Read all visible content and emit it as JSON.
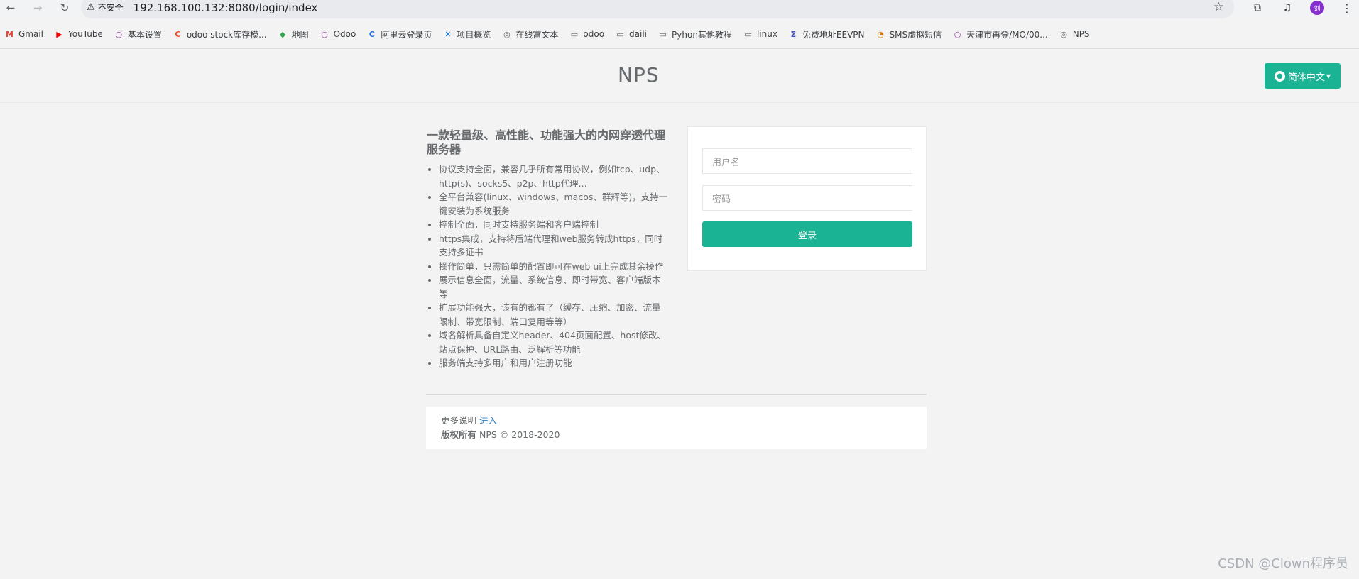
{
  "browser": {
    "security_label": "不安全",
    "url": "192.168.100.132:8080/login/index",
    "avatar_text": "刘",
    "bookmarks": [
      {
        "label": "Gmail",
        "icon": "gmail-icon",
        "color": "#ea4335"
      },
      {
        "label": "YouTube",
        "icon": "youtube-icon",
        "color": "#ff0000"
      },
      {
        "label": "基本设置",
        "icon": "circle-icon",
        "color": "#8e3b97"
      },
      {
        "label": "odoo stock库存模...",
        "icon": "c-icon",
        "color": "#f4511e"
      },
      {
        "label": "地图",
        "icon": "maps-icon",
        "color": "#34a853"
      },
      {
        "label": "Odoo",
        "icon": "circle-icon",
        "color": "#8e3b97"
      },
      {
        "label": "阿里云登录页",
        "icon": "c-icon",
        "color": "#1a73e8"
      },
      {
        "label": "项目概览",
        "icon": "x-icon",
        "color": "#1a73e8"
      },
      {
        "label": "在线富文本",
        "icon": "globe-icon",
        "color": "#5f6368"
      },
      {
        "label": "odoo",
        "icon": "folder-icon",
        "color": "#5f6368"
      },
      {
        "label": "daili",
        "icon": "folder-icon",
        "color": "#5f6368"
      },
      {
        "label": "Pyhon其他教程",
        "icon": "folder-icon",
        "color": "#5f6368"
      },
      {
        "label": "linux",
        "icon": "folder-icon",
        "color": "#5f6368"
      },
      {
        "label": "免费地址EEVPN",
        "icon": "sigma-icon",
        "color": "#3f51b5"
      },
      {
        "label": "SMS虚拟短信",
        "icon": "sms-icon",
        "color": "#e37400"
      },
      {
        "label": "天津市再登/MO/00...",
        "icon": "circle-icon",
        "color": "#8e3b97"
      },
      {
        "label": "NPS",
        "icon": "globe-icon",
        "color": "#5f6368"
      }
    ]
  },
  "header": {
    "brand": "NPS",
    "language": "简体中文"
  },
  "intro": {
    "title": "一款轻量级、高性能、功能强大的内网穿透代理服务器",
    "features": [
      "协议支持全面，兼容几乎所有常用协议，例如tcp、udp、http(s)、socks5、p2p、http代理...",
      "全平台兼容(linux、windows、macos、群辉等)，支持一键安装为系统服务",
      "控制全面，同时支持服务端和客户端控制",
      "https集成，支持将后端代理和web服务转成https，同时支持多证书",
      "操作简单，只需简单的配置即可在web ui上完成其余操作",
      "展示信息全面，流量、系统信息、即时带宽、客户端版本等",
      "扩展功能强大，该有的都有了（缓存、压缩、加密、流量限制、带宽限制、端口复用等等）",
      "域名解析具备自定义header、404页面配置、host修改、站点保护、URL路由、泛解析等功能",
      "服务端支持多用户和用户注册功能"
    ]
  },
  "login": {
    "username_placeholder": "用户名",
    "password_placeholder": "密码",
    "submit_label": "登录"
  },
  "footer": {
    "more_label": "更多说明",
    "more_link": "进入",
    "copyright_label": "版权所有",
    "copyright_text": "NPS © 2018-2020"
  },
  "watermark": "CSDN @Clown程序员",
  "colors": {
    "accent": "#1ab394",
    "link": "#337ab7"
  }
}
